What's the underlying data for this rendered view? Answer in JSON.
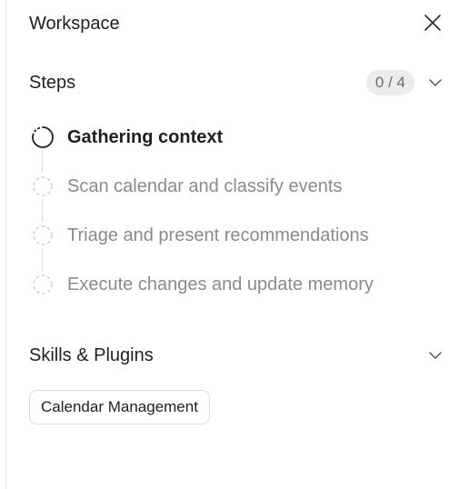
{
  "header": {
    "title": "Workspace",
    "close_icon": "close-icon"
  },
  "steps_section": {
    "title": "Steps",
    "count": "0 / 4",
    "chevron_icon": "chevron-down-icon",
    "items": [
      {
        "label": "Gathering context",
        "state": "in-progress"
      },
      {
        "label": "Scan calendar and classify events",
        "state": "pending"
      },
      {
        "label": "Triage and present recommendations",
        "state": "pending"
      },
      {
        "label": "Execute changes and update memory",
        "state": "pending"
      }
    ]
  },
  "skills_section": {
    "title": "Skills & Plugins",
    "chevron_icon": "chevron-down-icon",
    "chips": [
      {
        "label": "Calendar Management"
      }
    ]
  },
  "colors": {
    "text_primary": "#1f1f1f",
    "text_muted": "#8a8a8a",
    "badge_bg": "#ececec",
    "border": "#dcdcdc"
  }
}
